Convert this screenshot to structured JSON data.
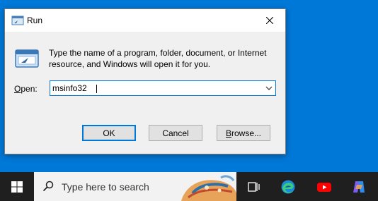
{
  "dialog": {
    "title": "Run",
    "description": "Type the name of a program, folder, document, or Internet resource, and Windows will open it for you.",
    "open_label_underlined": "O",
    "open_label_rest": "pen:",
    "input_value": "msinfo32",
    "buttons": {
      "ok": "OK",
      "cancel": "Cancel",
      "browse_underlined": "B",
      "browse_rest": "rowse..."
    }
  },
  "taskbar": {
    "search_placeholder": "Type here to search",
    "icons": [
      "windows-start-icon",
      "search-icon",
      "task-view-icon",
      "edge-icon",
      "youtube-icon",
      "copilot-icon"
    ]
  },
  "colors": {
    "desktop": "#0078d7",
    "accent": "#0078d7",
    "taskbar": "#1f1f1f",
    "youtube": "#ff0000"
  }
}
